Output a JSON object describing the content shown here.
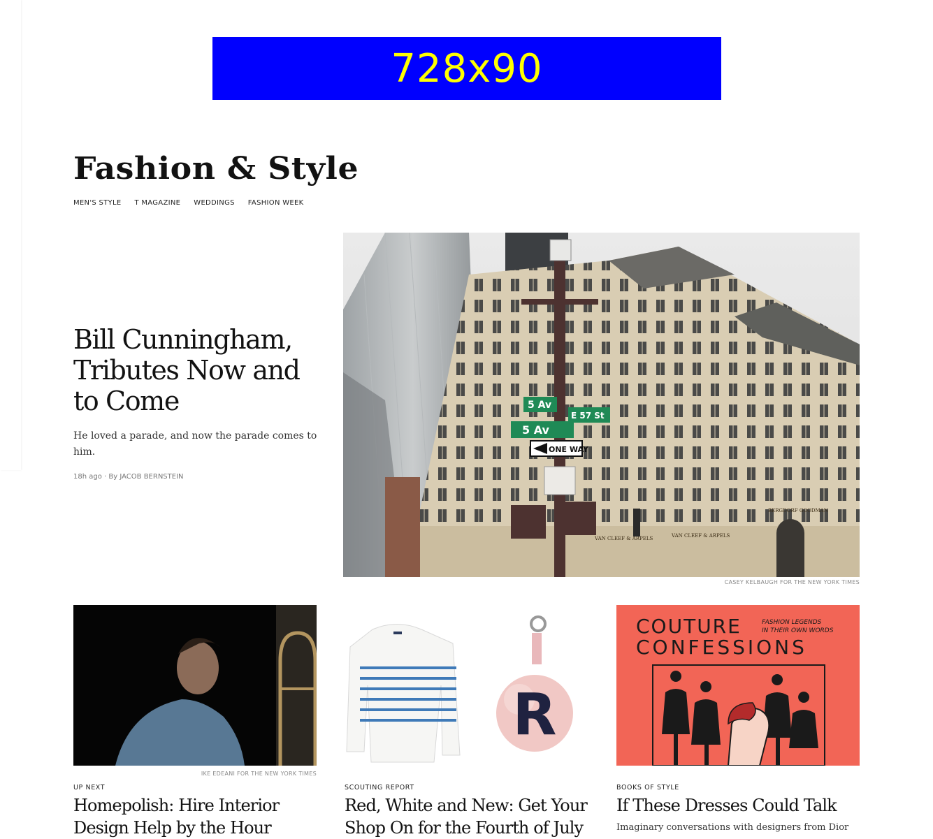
{
  "ad": {
    "label": "728x90"
  },
  "section": {
    "title": "Fashion & Style",
    "subnav": [
      "MEN'S STYLE",
      "T MAGAZINE",
      "WEDDINGS",
      "FASHION WEEK"
    ]
  },
  "lead": {
    "headline": "Bill Cunningham, Tributes Now and to Come",
    "summary": "He loved a parade, and now the parade comes to him.",
    "time": "18h ago",
    "by": "By",
    "author": "JACOB BERNSTEIN",
    "photo_credit": "CASEY KELBAUGH FOR THE NEW YORK TIMES",
    "street_signs": [
      "5 Av",
      "5 Av",
      "E 57 St",
      "ONE WAY"
    ],
    "storefront_signs": [
      "VAN CLEEF & ARPELS",
      "VAN CLEEF & ARPELS",
      "BERGDORF GOODMAN"
    ]
  },
  "cards": [
    {
      "kicker": "UP NEXT",
      "headline": "Homepolish: Hire Interior Design Help by the Hour",
      "credit": "IKE EDEANI FOR THE NEW YORK TIMES"
    },
    {
      "kicker": "SCOUTING REPORT",
      "headline": "Red, White and New: Get Your Shop On for the Fourth of July",
      "credit": "",
      "charm_letter": "R"
    },
    {
      "kicker": "BOOKS OF STYLE",
      "headline": "If These Dresses Could Talk",
      "summary": "Imaginary conversations with designers from Dior",
      "credit": "",
      "cover_title_1": "COUTURE",
      "cover_title_2": "CONFESSIONS",
      "cover_tagline_1": "FASHION LEGENDS",
      "cover_tagline_2": "IN THEIR OWN WORDS"
    }
  ],
  "colors": {
    "ad_bg": "#0000ff",
    "ad_text": "#ffff00",
    "book_cover": "#f26556"
  }
}
